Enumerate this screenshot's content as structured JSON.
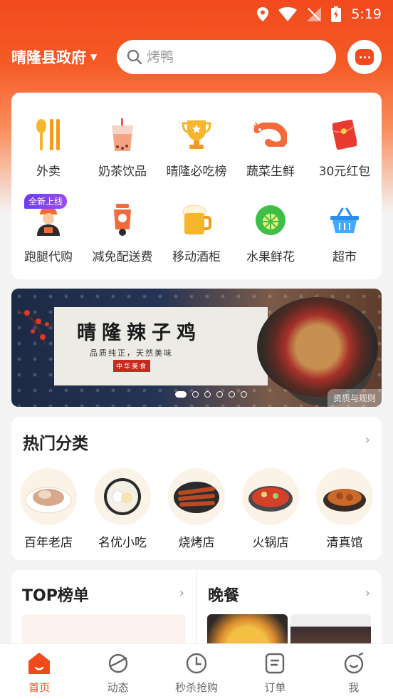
{
  "status_bar": {
    "time": "5:19"
  },
  "header": {
    "location": "晴隆县政府",
    "search_placeholder": "烤鸭"
  },
  "categories": [
    {
      "label": "外卖",
      "icon": "chopsticks-icon"
    },
    {
      "label": "奶茶饮品",
      "icon": "milk-tea-icon"
    },
    {
      "label": "晴隆必吃榜",
      "icon": "trophy-icon"
    },
    {
      "label": "蔬菜生鲜",
      "icon": "shrimp-icon"
    },
    {
      "label": "30元红包",
      "icon": "red-envelope-icon"
    },
    {
      "label": "跑腿代购",
      "icon": "courier-icon",
      "badge": "全新上线"
    },
    {
      "label": "减免配送费",
      "icon": "scooter-icon"
    },
    {
      "label": "移动酒柜",
      "icon": "beer-icon"
    },
    {
      "label": "水果鲜花",
      "icon": "lime-icon"
    },
    {
      "label": "超市",
      "icon": "basket-icon"
    }
  ],
  "banner": {
    "title": "晴隆辣子鸡",
    "subtitle": "品质纯正，天然美味",
    "stamp": "中华美食",
    "tag": "资质与规则",
    "slide_count": 6,
    "active_slide": 0
  },
  "hot": {
    "title": "热门分类",
    "items": [
      {
        "label": "百年老店"
      },
      {
        "label": "名优小吃"
      },
      {
        "label": "烧烤店"
      },
      {
        "label": "火锅店"
      },
      {
        "label": "清真馆"
      }
    ]
  },
  "top_list": {
    "title": "TOP榜单"
  },
  "dinner": {
    "title": "晚餐"
  },
  "tabs": [
    {
      "label": "首页",
      "icon": "home-icon",
      "active": true
    },
    {
      "label": "动态",
      "icon": "planet-icon"
    },
    {
      "label": "秒杀抢购",
      "icon": "clock-icon"
    },
    {
      "label": "订单",
      "icon": "order-icon"
    },
    {
      "label": "我",
      "icon": "profile-icon"
    }
  ],
  "colors": {
    "brand": "#f24a1d",
    "text": "#222222",
    "muted": "#666666"
  }
}
